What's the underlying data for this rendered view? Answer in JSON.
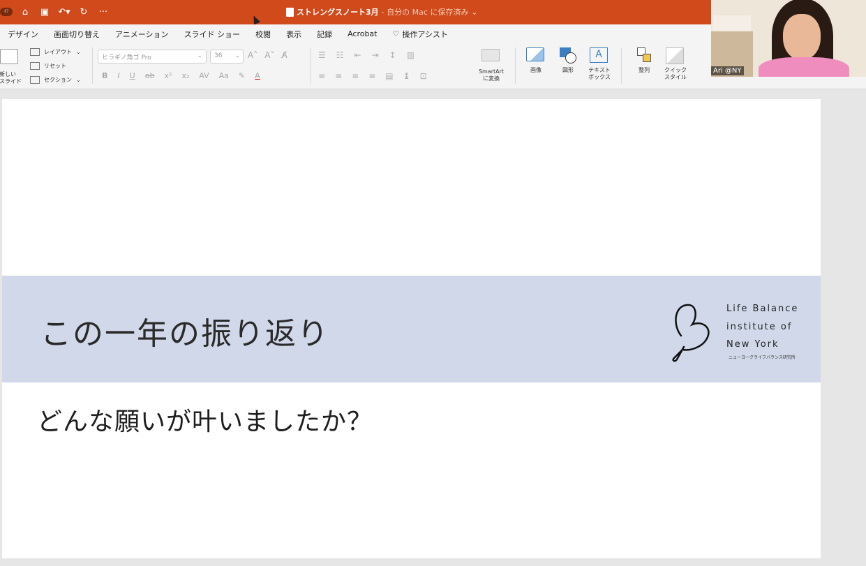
{
  "titlebar": {
    "app_badge": "ｵﾌ",
    "doc_title": "ストレングスノート3月",
    "save_status": "- 自分の Mac に保存済み",
    "color": "#d04a1b"
  },
  "tabs": [
    "デザイン",
    "画面切り替え",
    "アニメーション",
    "スライド ショー",
    "校閲",
    "表示",
    "記録",
    "Acrobat"
  ],
  "tell_me": "操作アシスト",
  "ribbon": {
    "new_slide_label": "新しい\nスライド",
    "layout": "レイアウト",
    "reset": "リセット",
    "section": "セクション",
    "font_name": "ヒラギノ角ゴ Pro",
    "font_size": "36",
    "smartart_label": "SmartArt\nに変換",
    "image_label": "画像",
    "shape_label": "図形",
    "textbox_label": "テキスト\nボックス",
    "arrange_label": "整列",
    "quickstyle_label": "クイック\nスタイル"
  },
  "slide": {
    "title": "この一年の振り返り",
    "body": "どんな願いが叶いましたか？",
    "band_color": "#d0d8e9",
    "logo": {
      "lines": [
        "Life Balance",
        "institute of",
        "New York"
      ],
      "sub": "ニューヨークライフバランス研究所"
    }
  },
  "video": {
    "participant_name": "Ari @NY"
  }
}
